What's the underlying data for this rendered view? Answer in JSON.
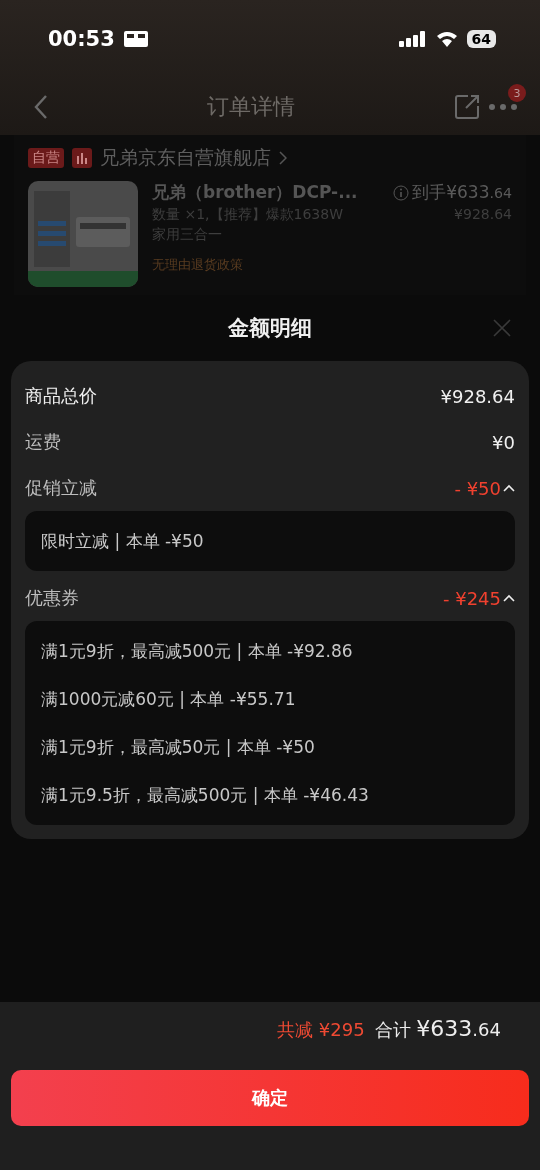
{
  "status_bar": {
    "time": "00:53",
    "battery": "64"
  },
  "nav": {
    "title": "订单详情",
    "badge": "3"
  },
  "store": {
    "tag": "自营",
    "name": "兄弟京东自营旗舰店"
  },
  "product": {
    "title": "兄弟（brother）DCP-...",
    "price_label": "到手",
    "price": "¥633",
    "price_decimal": ".64",
    "spec_lines": [
      "数量 ×1,【推荐】爆款1638W",
      "家用三合一"
    ],
    "original_price": "¥928.64",
    "policy": "无理由退货政策"
  },
  "sheet": {
    "title": "金额明细",
    "rows": [
      {
        "kind": "main",
        "label": "商品总价",
        "value": "¥928.64"
      },
      {
        "kind": "plain",
        "label": "运费",
        "value": "¥0"
      },
      {
        "kind": "discount",
        "label": "促销立减",
        "value": "- ¥50",
        "expanded": true,
        "items": [
          "限时立减 | 本单 -¥50"
        ]
      },
      {
        "kind": "discount",
        "label": "优惠券",
        "value": "- ¥245",
        "expanded": true,
        "items": [
          "满1元9折，最高减500元 | 本单 -¥92.86",
          "满1000元减60元 | 本单 -¥55.71",
          "满1元9折，最高减50元 | 本单 -¥50",
          "满1元9.5折，最高减500元 | 本单 -¥46.43"
        ]
      }
    ]
  },
  "footer": {
    "saved_label": "共减",
    "saved": "¥295",
    "total_label": "合计",
    "total": "¥633",
    "total_decimal": ".64",
    "confirm": "确定"
  }
}
